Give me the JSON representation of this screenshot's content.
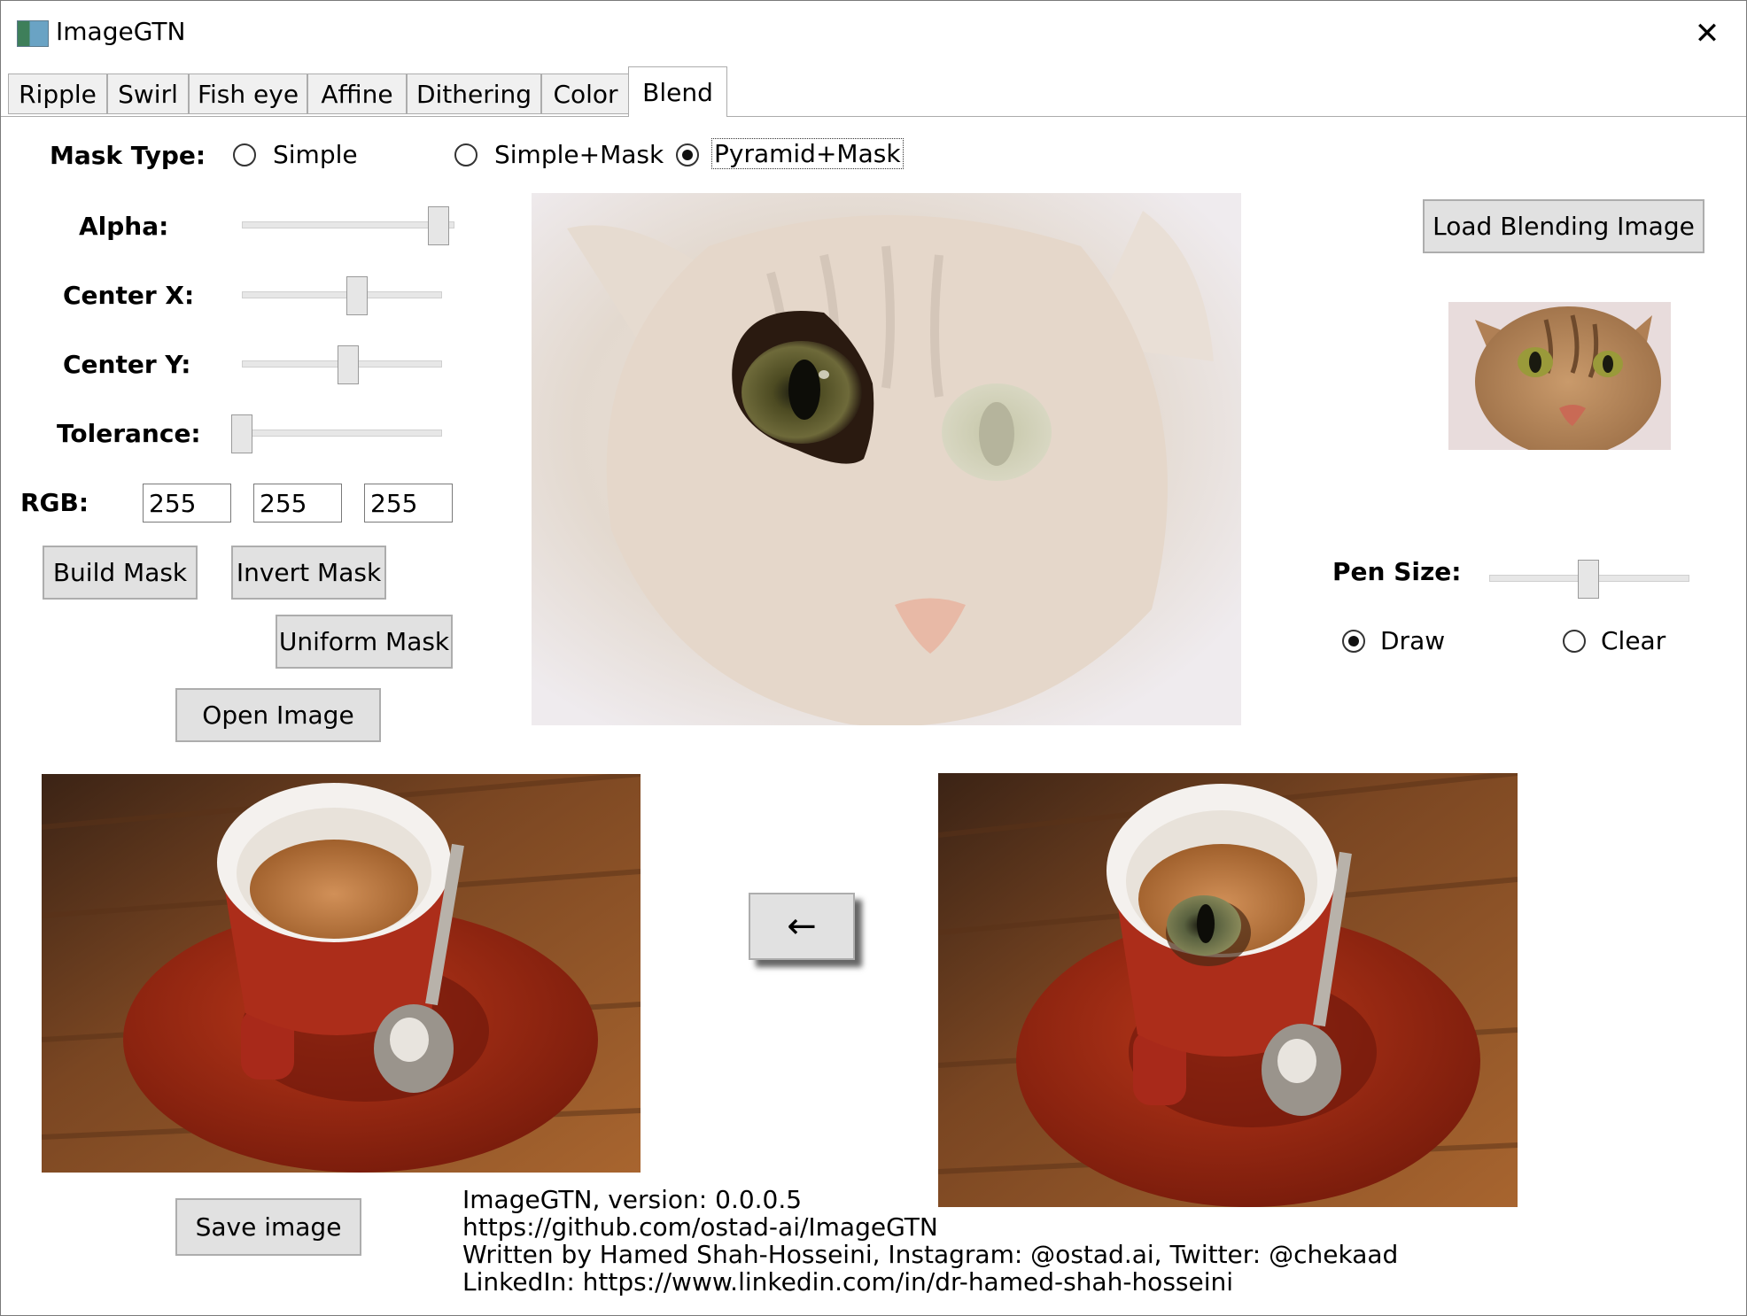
{
  "window": {
    "title": "ImageGTN",
    "close_glyph": "✕"
  },
  "tabs": [
    {
      "label": "Ripple"
    },
    {
      "label": "Swirl"
    },
    {
      "label": "Fish eye"
    },
    {
      "label": "Affine"
    },
    {
      "label": "Dithering"
    },
    {
      "label": "Color"
    },
    {
      "label": "Blend",
      "active": true
    }
  ],
  "mask_type": {
    "label": "Mask Type:",
    "options": [
      {
        "label": "Simple",
        "checked": false
      },
      {
        "label": "Simple+Mask",
        "checked": false
      },
      {
        "label": "Pyramid+Mask",
        "checked": true
      }
    ]
  },
  "sliders": {
    "alpha": {
      "label": "Alpha:",
      "value": 1.0
    },
    "center_x": {
      "label": "Center X:",
      "value": 0.58
    },
    "center_y": {
      "label": "Center Y:",
      "value": 0.53
    },
    "tolerance": {
      "label": "Tolerance:",
      "value": 0.0
    },
    "pen_size": {
      "label": "Pen Size:",
      "value": 0.5
    }
  },
  "rgb": {
    "label": "RGB:",
    "r": "255",
    "g": "255",
    "b": "255"
  },
  "buttons": {
    "build_mask": "Build Mask",
    "invert_mask": "Invert Mask",
    "uniform_mask": "Uniform Mask",
    "open_image": "Open Image",
    "load_blending_image": "Load Blending Image",
    "apply_arrow": "←",
    "save_image": "Save image"
  },
  "pen_mode": {
    "options": [
      {
        "label": "Draw",
        "checked": true
      },
      {
        "label": "Clear",
        "checked": false
      }
    ]
  },
  "images": {
    "mask_preview": "cat-face-faded-with-eye-mask",
    "blend_thumbnail": "cat-face",
    "source": "espresso-cup-on-red-saucer",
    "result": "espresso-cup-with-cat-eye"
  },
  "info": {
    "version": "ImageGTN, version: 0.0.0.5",
    "url": "https://github.com/ostad-ai/ImageGTN",
    "author": "Written by Hamed Shah-Hosseini, Instagram: @ostad.ai, Twitter: @chekaad",
    "linkedin": "LinkedIn: https://www.linkedin.com/in/dr-hamed-shah-hosseini"
  }
}
